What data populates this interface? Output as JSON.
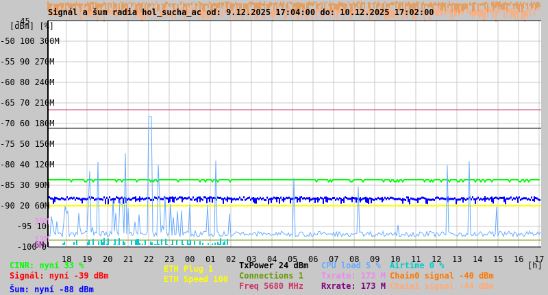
{
  "title": "Signál a šum radia hol_sucha_ac od: 9.12.2025 17:04:00 do: 10.12.2025 17:02:00",
  "y_axis_top_label": "-45",
  "y_axis_units": "[dBm] [%]",
  "y_axis_labels": [
    "-50 100 300M",
    "-55 90 270M",
    "-60 80 240M",
    "-65 70 210M",
    "-70 60 180M",
    "-75 50 150M",
    "-80 40 120M",
    "-85 30 90M",
    "-90 20 60M",
    "-95 10",
    "-100 0"
  ],
  "y_extra_labels": {
    "m39": "39M",
    "m13": "13M",
    "m6": "6M"
  },
  "x_axis_labels": [
    "18",
    "19",
    "20",
    "21",
    "22",
    "23",
    "00",
    "01",
    "02",
    "03",
    "04",
    "05",
    "06",
    "07",
    "08",
    "09",
    "10",
    "11",
    "12",
    "13",
    "14",
    "15",
    "16",
    "17"
  ],
  "x_unit": "[h]",
  "legend": {
    "cinr": "CINR: nyní 33 %",
    "signal": "Signál: nyní -39 dBm",
    "noise": "Šum: nyní -88 dBm",
    "eth_plug": "ETH Plug 1",
    "eth_speed": "ETH Speed 100",
    "txpower": "TxPower 24 dBm",
    "connections": "Connections 1",
    "freq": "Freq 5680 MHz",
    "cpu": "CPU load 5 %",
    "txrate": "Txrate: 173 M",
    "rxrate": "Rxrate: 173 M",
    "airtime": "Airtime 0 %",
    "chain0": "Chain0 signal -40 dBm",
    "chain1": "Chain1 signal -44 dBm"
  },
  "colors": {
    "cinr": "#00ff00",
    "signal": "#ff0000",
    "noise": "#0000ff",
    "eth": "#ffff00",
    "txpower": "#000000",
    "connections": "#669900",
    "freq": "#cc3366",
    "cpu": "#66aaff",
    "txrate": "#ee88ee",
    "rxrate": "#800080",
    "airtime": "#00cccc",
    "chain0": "#ff7700",
    "chain1": "#ffaa77"
  }
}
